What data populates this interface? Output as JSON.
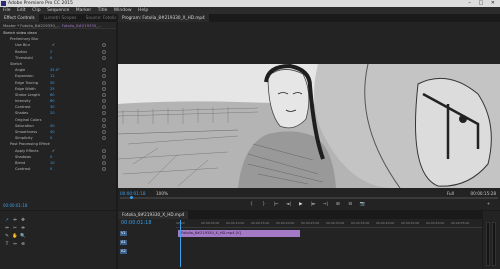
{
  "app": {
    "title": "Adobe Premiere Pro CC 2015",
    "window_controls": [
      "–",
      "□",
      "✕"
    ]
  },
  "menu": [
    "File",
    "Edit",
    "Clip",
    "Sequence",
    "Marker",
    "Title",
    "Window",
    "Help"
  ],
  "effect_controls": {
    "tabs": [
      "Effect Controls",
      "Lumetri Scopes",
      "Source: Fotolia"
    ],
    "header_master": "Master * Fotolia_8#219330_...",
    "header_clip": "Fotolia_8#219330_...",
    "rows": [
      {
        "label": "Sketch video clean",
        "kind": "section"
      },
      {
        "label": "Preliminary Blur",
        "kind": "sub"
      },
      {
        "label": "Use Blur",
        "kind": "sub2",
        "check": "✓"
      },
      {
        "label": "Radius",
        "kind": "sub2",
        "value": "2"
      },
      {
        "label": "Threshold",
        "kind": "sub2",
        "value": "0"
      },
      {
        "label": "Sketch",
        "kind": "sub"
      },
      {
        "label": "Angle",
        "kind": "sub2",
        "value": "45.0°"
      },
      {
        "label": "Expansion",
        "kind": "sub2",
        "value": "12"
      },
      {
        "label": "Edge Tracing",
        "kind": "sub2",
        "value": "50"
      },
      {
        "label": "Edge Width",
        "kind": "sub2",
        "value": "25"
      },
      {
        "label": "Stroke Length",
        "kind": "sub2",
        "value": "60"
      },
      {
        "label": "Intensity",
        "kind": "sub2",
        "value": "60"
      },
      {
        "label": "Contrast",
        "kind": "sub2",
        "value": "30"
      },
      {
        "label": "Shades",
        "kind": "sub2",
        "value": "20"
      },
      {
        "label": "Original Colors",
        "kind": "sub2",
        "value": ""
      },
      {
        "label": "Saturation",
        "kind": "sub2",
        "value": "50"
      },
      {
        "label": "Smoothness",
        "kind": "sub2",
        "value": "40"
      },
      {
        "label": "Simplicity",
        "kind": "sub2",
        "value": "0"
      },
      {
        "label": "Post Processing Effects",
        "kind": "sub"
      },
      {
        "label": "Apply Effects",
        "kind": "sub2",
        "check": "✓"
      },
      {
        "label": "Shadows",
        "kind": "sub2",
        "value": "0"
      },
      {
        "label": "Blend",
        "kind": "sub2",
        "value": "10"
      },
      {
        "label": "Contrast",
        "kind": "sub2",
        "value": "0"
      }
    ],
    "timecode": "00:00:01:18"
  },
  "program_monitor": {
    "tab": "Program: Fotolia_8#219330_X_HD.mp4",
    "timecode_current": "00:00:01:18",
    "zoom": "100%",
    "resolution": "Full",
    "timecode_duration": "00:00:15:28",
    "transport_icons": [
      "{",
      "}",
      "|←",
      "◄|",
      "▶",
      "|►",
      "→|",
      "⊞",
      "⊟",
      "📷",
      "+"
    ]
  },
  "project": {
    "tool_icons": [
      "➚",
      "⇹",
      "✥",
      "⇔",
      "✂",
      "⇼",
      "✎",
      "✋",
      "🔍",
      "T",
      "↔",
      "⊕"
    ]
  },
  "timeline": {
    "tab": "Fotolia_8#219330_X_HD.mp4",
    "timecode": "00:00:01:18",
    "ruler_ticks": [
      "00:00",
      "00:00:05:00",
      "00:00:10:00",
      "00:00:15:00",
      "00:00:20:00",
      "00:00:25:00",
      "00:00:30:00",
      "00:00:35:00",
      "00:00:40:00",
      "00:00:45:00",
      "00:00:50:00",
      "00:00:55:00"
    ],
    "tracks": [
      {
        "id": "V1",
        "label": "V1",
        "clip": "Fotolia_8#219330_X_HD.mp4 [V]"
      },
      {
        "id": "A1",
        "label": "A1",
        "clip": ""
      },
      {
        "id": "A2",
        "label": "A2",
        "clip": ""
      }
    ]
  },
  "colors": {
    "accent": "#3c9fe8",
    "clip": "#a47ac6",
    "panel": "#232323"
  }
}
